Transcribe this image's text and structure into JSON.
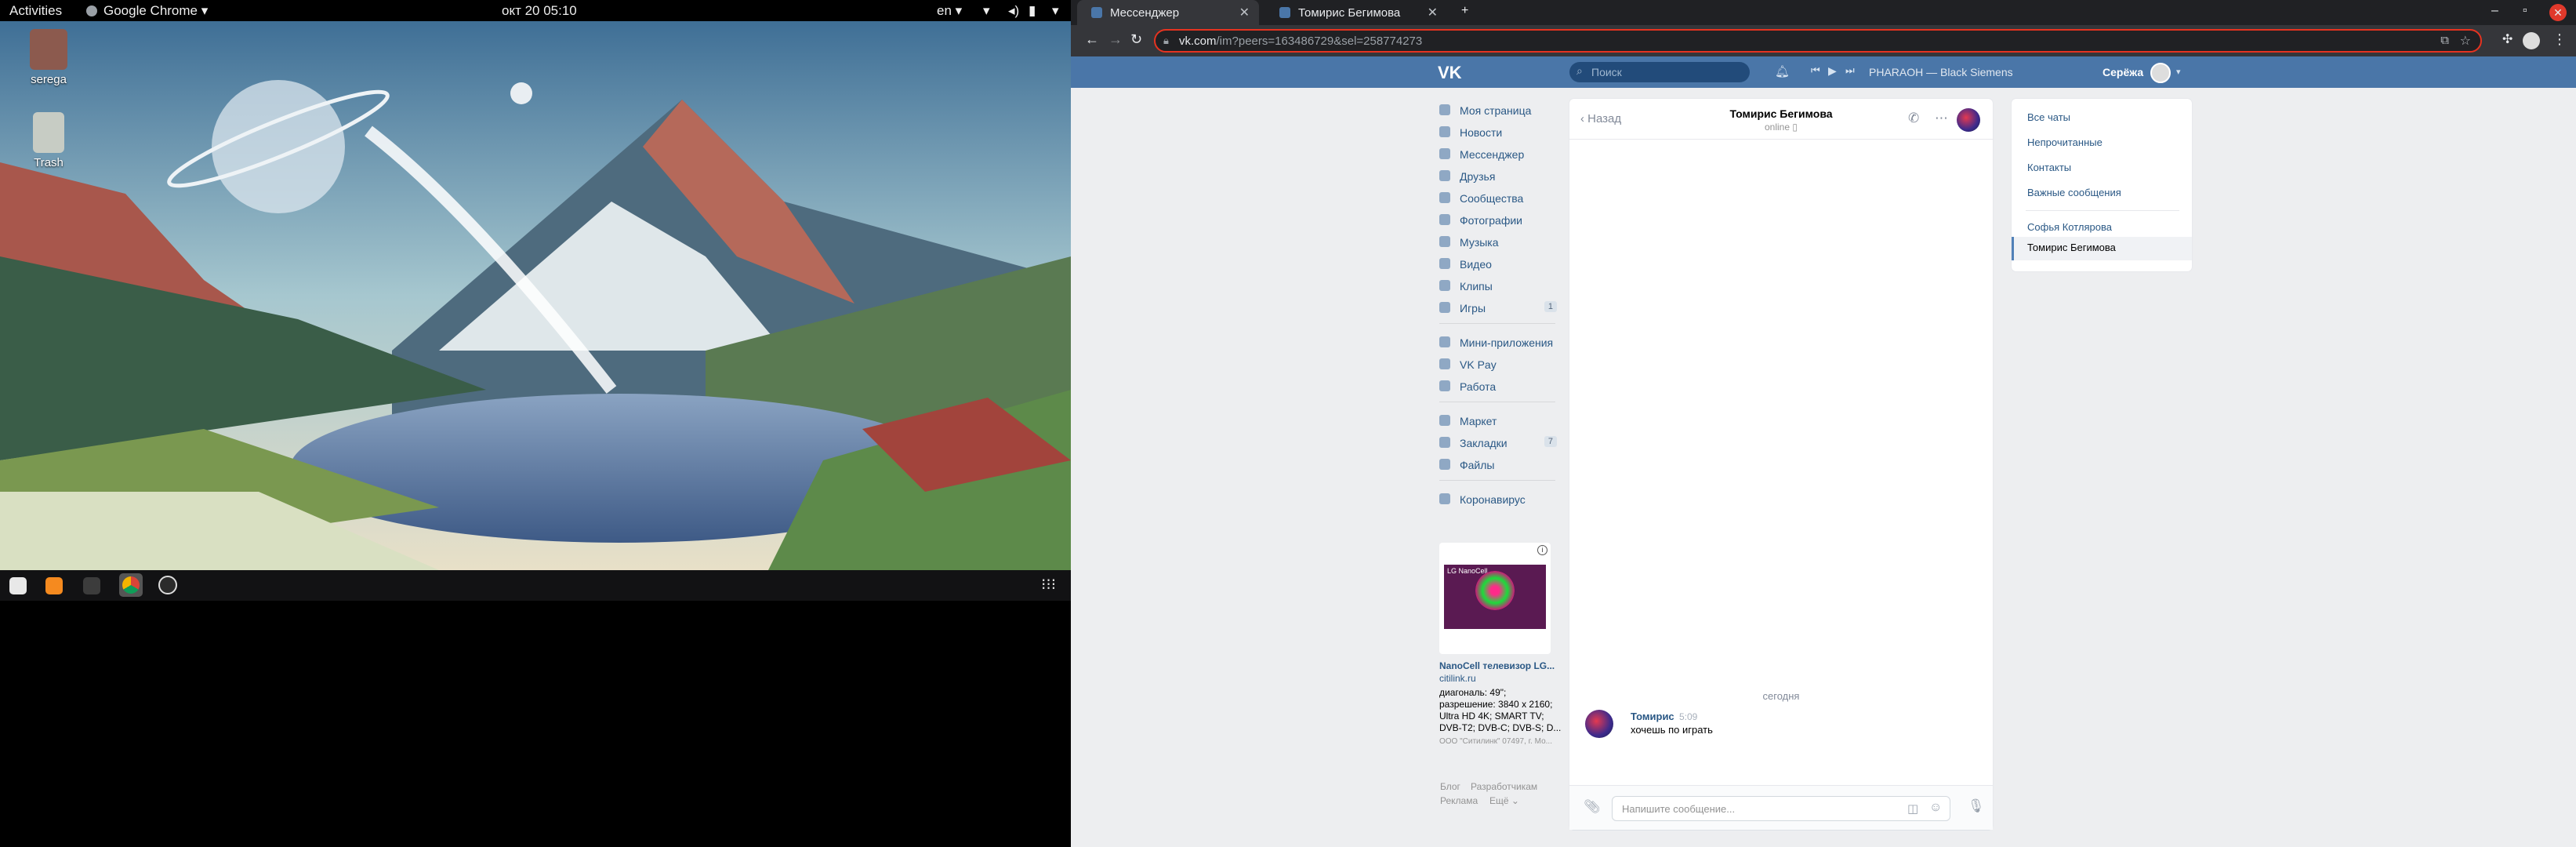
{
  "gnome": {
    "activities": "Activities",
    "app_name": "Google Chrome",
    "clock": "окт 20  05:10",
    "lang": "en"
  },
  "desktop": {
    "icons": [
      {
        "label": "serega",
        "icon": "home-folder-icon"
      },
      {
        "label": "Trash",
        "icon": "trash-icon"
      }
    ]
  },
  "dock": {
    "items": [
      "files-icon",
      "sublime-icon",
      "terminal-icon",
      "chrome-icon",
      "app-icon"
    ],
    "apps_grid": "show-apps-icon"
  },
  "chrome": {
    "tabs": [
      {
        "title": "Мессенджер",
        "active": true
      },
      {
        "title": "Томирис Бегимова",
        "active": false
      }
    ],
    "url_host": "vk.com",
    "url_path": "/im?peers=163486729&sel=258774273"
  },
  "vk": {
    "logo": "VK",
    "search_placeholder": "Поиск",
    "now_playing": "PHARAOH — Black Siemens",
    "user_name": "Серёжа",
    "menu": [
      {
        "label": "Моя страница",
        "icon": "profile-icon"
      },
      {
        "label": "Новости",
        "icon": "news-icon"
      },
      {
        "label": "Мессенджер",
        "icon": "messenger-icon"
      },
      {
        "label": "Друзья",
        "icon": "friends-icon"
      },
      {
        "label": "Сообщества",
        "icon": "communities-icon"
      },
      {
        "label": "Фотографии",
        "icon": "photos-icon"
      },
      {
        "label": "Музыка",
        "icon": "music-icon"
      },
      {
        "label": "Видео",
        "icon": "video-icon"
      },
      {
        "label": "Клипы",
        "icon": "clips-icon"
      },
      {
        "label": "Игры",
        "icon": "games-icon",
        "count": "1"
      },
      {
        "label": "Мини-приложения",
        "icon": "mini-apps-icon"
      },
      {
        "label": "VK Pay",
        "icon": "vkpay-icon"
      },
      {
        "label": "Работа",
        "icon": "work-icon"
      },
      {
        "label": "Маркет",
        "icon": "market-icon"
      },
      {
        "label": "Закладки",
        "icon": "bookmarks-icon",
        "count": "7"
      },
      {
        "label": "Файлы",
        "icon": "files-icon"
      },
      {
        "label": "Коронавирус",
        "icon": "covid-icon"
      }
    ],
    "ad": {
      "tv_label": "LG NanoCell",
      "title": "NanoCell телевизор LG...",
      "domain": "citilink.ru",
      "lines": [
        "диагональ: 49\";",
        "разрешение: 3840 x 2160;",
        "Ultra HD 4K; SMART TV;",
        "DVB-T2; DVB-C; DVB-S; D..."
      ],
      "legal": "ООО \"Ситилинк\" 07497, г. Мо..."
    },
    "footer": {
      "blog": "Блог",
      "developers": "Разработчикам",
      "ads": "Реклама",
      "more": "Ещё ⌄"
    },
    "chat": {
      "back": "Назад",
      "name": "Томирис Бегимова",
      "status": "online",
      "date": "сегодня",
      "message": {
        "author": "Томирис",
        "time": "5:09",
        "text": "хочешь по играть"
      },
      "composer_placeholder": "Напишите сообщение..."
    },
    "filters": {
      "all": "Все чаты",
      "unread": "Непрочитанные",
      "contacts": "Контакты",
      "important": "Важные сообщения",
      "chat1": "Софья Котлярова",
      "chat2": "Томирис Бегимова"
    },
    "colors": {
      "header": "#4a76a8",
      "link": "#2a5885",
      "accent": "#5181b8"
    }
  }
}
